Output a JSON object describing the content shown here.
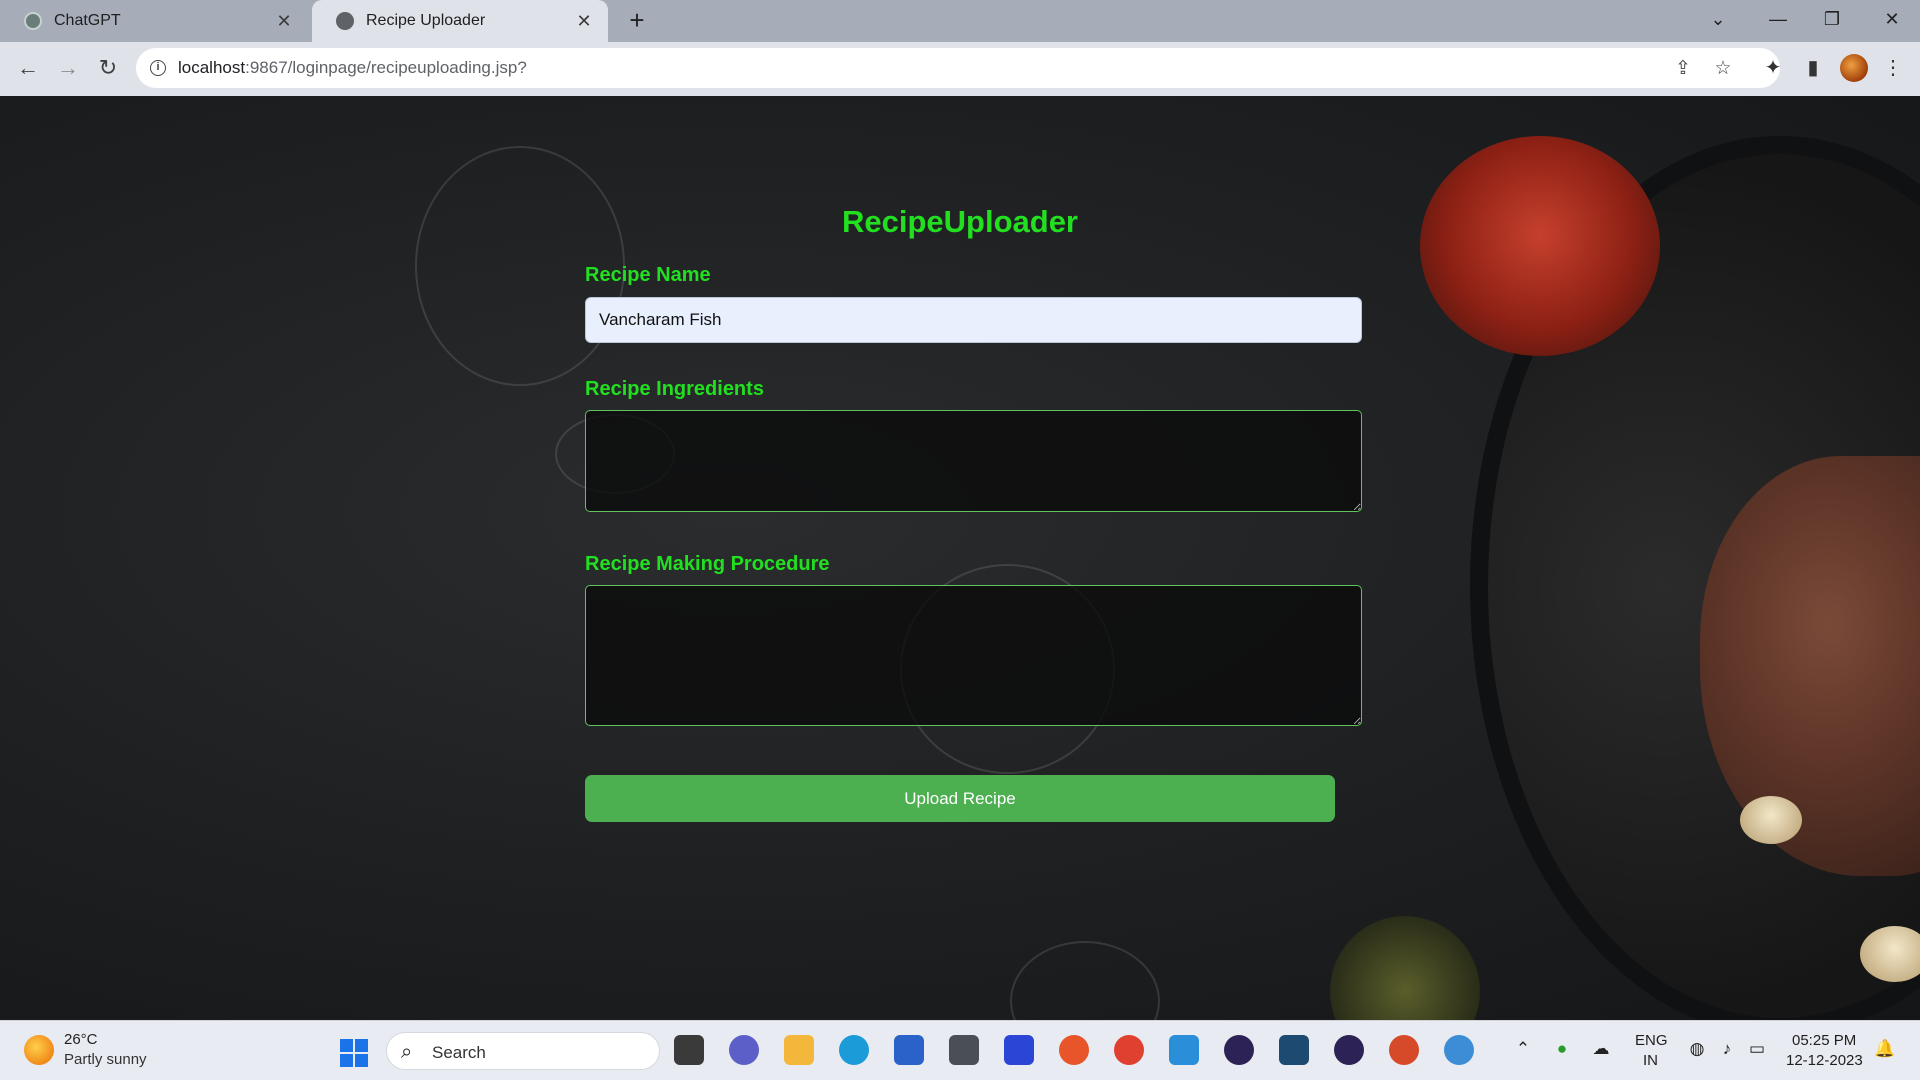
{
  "browser": {
    "tabs": [
      {
        "title": "ChatGPT",
        "active": false
      },
      {
        "title": "Recipe Uploader",
        "active": true
      }
    ],
    "url_host": "localhost",
    "url_rest": ":9867/loginpage/recipeuploading.jsp?"
  },
  "form": {
    "title": "RecipeUploader",
    "recipe_name_label": "Recipe Name",
    "recipe_name_value": "Vancharam Fish",
    "ingredients_label": "Recipe Ingredients",
    "ingredients_value": "",
    "procedure_label": "Recipe Making Procedure",
    "procedure_value": "",
    "submit_label": "Upload Recipe"
  },
  "taskbar": {
    "weather_temp": "26°C",
    "weather_desc": "Partly sunny",
    "search_placeholder": "Search",
    "lang_top": "ENG",
    "lang_bottom": "IN",
    "time": "05:25 PM",
    "date": "12-12-2023"
  },
  "colors": {
    "accent_green": "#22e020",
    "button_green": "#4caf50"
  }
}
